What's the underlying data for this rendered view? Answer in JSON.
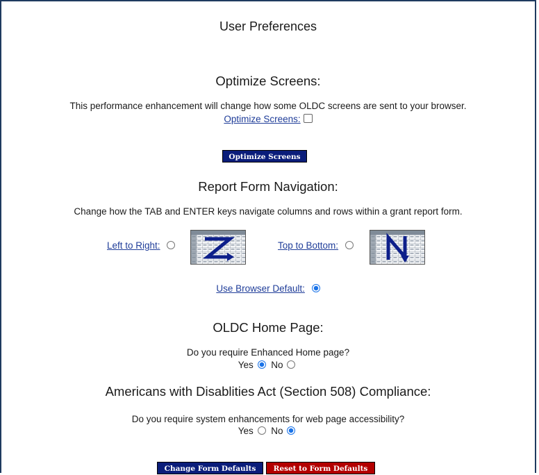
{
  "page": {
    "title": "User Preferences"
  },
  "optimize": {
    "heading": "Optimize Screens:",
    "description": "This performance enhancement will change how some OLDC screens are sent to your browser.",
    "checkbox_label": "Optimize Screens:",
    "checked": false,
    "button_label": "Optimize Screens"
  },
  "navigation": {
    "heading": "Report Form Navigation:",
    "description": "Change how the TAB and ENTER keys navigate columns and rows within a grant report form.",
    "left_to_right_label": "Left to Right:",
    "top_to_bottom_label": "Top to Bottom:",
    "browser_default_label": "Use Browser Default:",
    "selected": "browser_default",
    "left_icon": "z-pattern-grid-icon",
    "top_icon": "n-pattern-grid-icon"
  },
  "home_page": {
    "heading": "OLDC Home Page:",
    "question": "Do you require Enhanced Home page?",
    "yes_label": "Yes",
    "no_label": "No",
    "selected": "yes"
  },
  "ada": {
    "heading": "Americans with Disablities Act (Section 508) Compliance:",
    "question": "Do you require system enhancements for web page accessibility?",
    "yes_label": "Yes",
    "no_label": "No",
    "selected": "no"
  },
  "footer": {
    "change_defaults_label": "Change Form Defaults",
    "reset_defaults_label": "Reset to Form Defaults"
  },
  "colors": {
    "link": "#1f3d99",
    "navy_button": "#0a1d7a",
    "red_button": "#b30000",
    "radio_selected": "#1a73e8",
    "frame": "#1f3a5f"
  }
}
